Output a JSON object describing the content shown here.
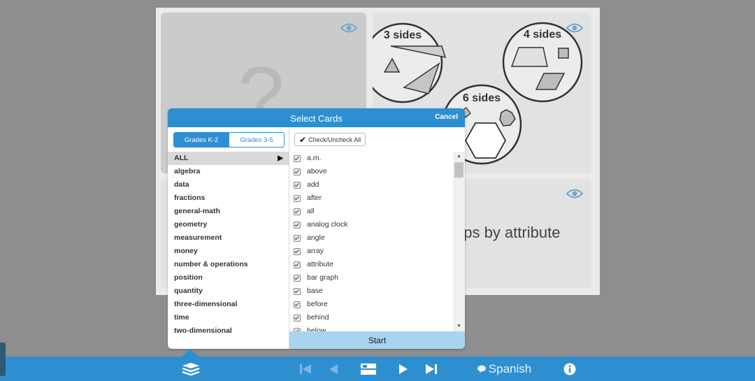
{
  "stage": {
    "card_question_mark": "?",
    "card_shapes_labels": [
      "3 sides",
      "4 sides",
      "6 sides"
    ],
    "card_partial_text": "ups by attribute"
  },
  "modal": {
    "title": "Select Cards",
    "cancel_label": "Cancel",
    "grade_tabs": [
      "Grades K-2",
      "Grades 3-5"
    ],
    "check_all_label": "Check/Uncheck All",
    "categories": [
      "ALL",
      "algebra",
      "data",
      "fractions",
      "general-math",
      "geometry",
      "measurement",
      "money",
      "number & operations",
      "position",
      "quantity",
      "three-dimensional",
      "time",
      "two-dimensional"
    ],
    "items": [
      "a.m.",
      "above",
      "add",
      "after",
      "all",
      "analog clock",
      "angle",
      "array",
      "attribute",
      "bar graph",
      "base",
      "before",
      "behind",
      "below"
    ],
    "start_label": "Start"
  },
  "taskbar": {
    "language_label": "Spanish"
  },
  "colors": {
    "accent": "#2e8fd0",
    "start_button": "#a9d4ef",
    "background": "#8e8e8e"
  }
}
